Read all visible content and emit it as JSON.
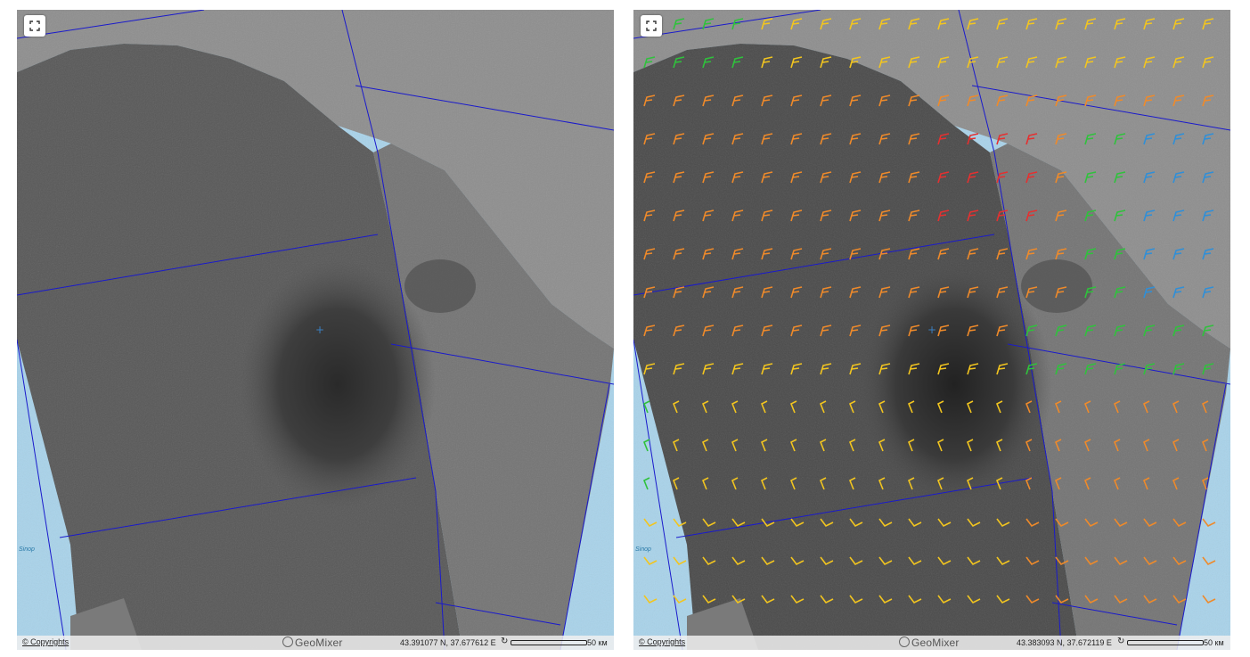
{
  "left_panel": {
    "fullscreen_icon": "expand-icon",
    "copyright_label": "© Copyrights",
    "brand_label": "GeoMixer",
    "coordinates": "43.391077 N, 37.677612 E",
    "scale_label": "50 км",
    "place_label": "Sinop"
  },
  "right_panel": {
    "fullscreen_icon": "expand-icon",
    "copyright_label": "© Copyrights",
    "brand_label": "GeoMixer",
    "coordinates": "43.383093 N, 37.672119 E",
    "scale_label": "50 км",
    "place_label": "Sinop"
  },
  "colors": {
    "sea": "#a9d3ea",
    "footprint_border": "#1a1acc",
    "wind_red": "#e53030",
    "wind_orange": "#ef8a2a",
    "wind_yellow": "#f2c51f",
    "wind_green": "#2fc23c",
    "wind_blue": "#2f8fd8"
  }
}
